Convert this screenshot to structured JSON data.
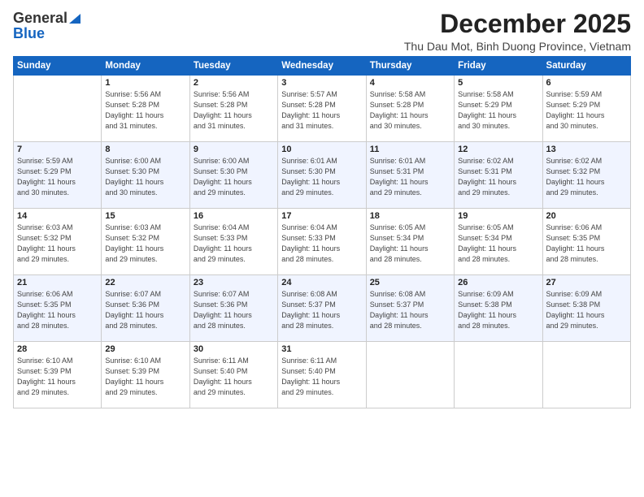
{
  "header": {
    "logo_general": "General",
    "logo_blue": "Blue",
    "month": "December 2025",
    "location": "Thu Dau Mot, Binh Duong Province, Vietnam"
  },
  "weekdays": [
    "Sunday",
    "Monday",
    "Tuesday",
    "Wednesday",
    "Thursday",
    "Friday",
    "Saturday"
  ],
  "weeks": [
    [
      {
        "day": "",
        "info": ""
      },
      {
        "day": "1",
        "info": "Sunrise: 5:56 AM\nSunset: 5:28 PM\nDaylight: 11 hours\nand 31 minutes."
      },
      {
        "day": "2",
        "info": "Sunrise: 5:56 AM\nSunset: 5:28 PM\nDaylight: 11 hours\nand 31 minutes."
      },
      {
        "day": "3",
        "info": "Sunrise: 5:57 AM\nSunset: 5:28 PM\nDaylight: 11 hours\nand 31 minutes."
      },
      {
        "day": "4",
        "info": "Sunrise: 5:58 AM\nSunset: 5:28 PM\nDaylight: 11 hours\nand 30 minutes."
      },
      {
        "day": "5",
        "info": "Sunrise: 5:58 AM\nSunset: 5:29 PM\nDaylight: 11 hours\nand 30 minutes."
      },
      {
        "day": "6",
        "info": "Sunrise: 5:59 AM\nSunset: 5:29 PM\nDaylight: 11 hours\nand 30 minutes."
      }
    ],
    [
      {
        "day": "7",
        "info": "Sunrise: 5:59 AM\nSunset: 5:29 PM\nDaylight: 11 hours\nand 30 minutes."
      },
      {
        "day": "8",
        "info": "Sunrise: 6:00 AM\nSunset: 5:30 PM\nDaylight: 11 hours\nand 30 minutes."
      },
      {
        "day": "9",
        "info": "Sunrise: 6:00 AM\nSunset: 5:30 PM\nDaylight: 11 hours\nand 29 minutes."
      },
      {
        "day": "10",
        "info": "Sunrise: 6:01 AM\nSunset: 5:30 PM\nDaylight: 11 hours\nand 29 minutes."
      },
      {
        "day": "11",
        "info": "Sunrise: 6:01 AM\nSunset: 5:31 PM\nDaylight: 11 hours\nand 29 minutes."
      },
      {
        "day": "12",
        "info": "Sunrise: 6:02 AM\nSunset: 5:31 PM\nDaylight: 11 hours\nand 29 minutes."
      },
      {
        "day": "13",
        "info": "Sunrise: 6:02 AM\nSunset: 5:32 PM\nDaylight: 11 hours\nand 29 minutes."
      }
    ],
    [
      {
        "day": "14",
        "info": "Sunrise: 6:03 AM\nSunset: 5:32 PM\nDaylight: 11 hours\nand 29 minutes."
      },
      {
        "day": "15",
        "info": "Sunrise: 6:03 AM\nSunset: 5:32 PM\nDaylight: 11 hours\nand 29 minutes."
      },
      {
        "day": "16",
        "info": "Sunrise: 6:04 AM\nSunset: 5:33 PM\nDaylight: 11 hours\nand 29 minutes."
      },
      {
        "day": "17",
        "info": "Sunrise: 6:04 AM\nSunset: 5:33 PM\nDaylight: 11 hours\nand 28 minutes."
      },
      {
        "day": "18",
        "info": "Sunrise: 6:05 AM\nSunset: 5:34 PM\nDaylight: 11 hours\nand 28 minutes."
      },
      {
        "day": "19",
        "info": "Sunrise: 6:05 AM\nSunset: 5:34 PM\nDaylight: 11 hours\nand 28 minutes."
      },
      {
        "day": "20",
        "info": "Sunrise: 6:06 AM\nSunset: 5:35 PM\nDaylight: 11 hours\nand 28 minutes."
      }
    ],
    [
      {
        "day": "21",
        "info": "Sunrise: 6:06 AM\nSunset: 5:35 PM\nDaylight: 11 hours\nand 28 minutes."
      },
      {
        "day": "22",
        "info": "Sunrise: 6:07 AM\nSunset: 5:36 PM\nDaylight: 11 hours\nand 28 minutes."
      },
      {
        "day": "23",
        "info": "Sunrise: 6:07 AM\nSunset: 5:36 PM\nDaylight: 11 hours\nand 28 minutes."
      },
      {
        "day": "24",
        "info": "Sunrise: 6:08 AM\nSunset: 5:37 PM\nDaylight: 11 hours\nand 28 minutes."
      },
      {
        "day": "25",
        "info": "Sunrise: 6:08 AM\nSunset: 5:37 PM\nDaylight: 11 hours\nand 28 minutes."
      },
      {
        "day": "26",
        "info": "Sunrise: 6:09 AM\nSunset: 5:38 PM\nDaylight: 11 hours\nand 28 minutes."
      },
      {
        "day": "27",
        "info": "Sunrise: 6:09 AM\nSunset: 5:38 PM\nDaylight: 11 hours\nand 29 minutes."
      }
    ],
    [
      {
        "day": "28",
        "info": "Sunrise: 6:10 AM\nSunset: 5:39 PM\nDaylight: 11 hours\nand 29 minutes."
      },
      {
        "day": "29",
        "info": "Sunrise: 6:10 AM\nSunset: 5:39 PM\nDaylight: 11 hours\nand 29 minutes."
      },
      {
        "day": "30",
        "info": "Sunrise: 6:11 AM\nSunset: 5:40 PM\nDaylight: 11 hours\nand 29 minutes."
      },
      {
        "day": "31",
        "info": "Sunrise: 6:11 AM\nSunset: 5:40 PM\nDaylight: 11 hours\nand 29 minutes."
      },
      {
        "day": "",
        "info": ""
      },
      {
        "day": "",
        "info": ""
      },
      {
        "day": "",
        "info": ""
      }
    ]
  ]
}
